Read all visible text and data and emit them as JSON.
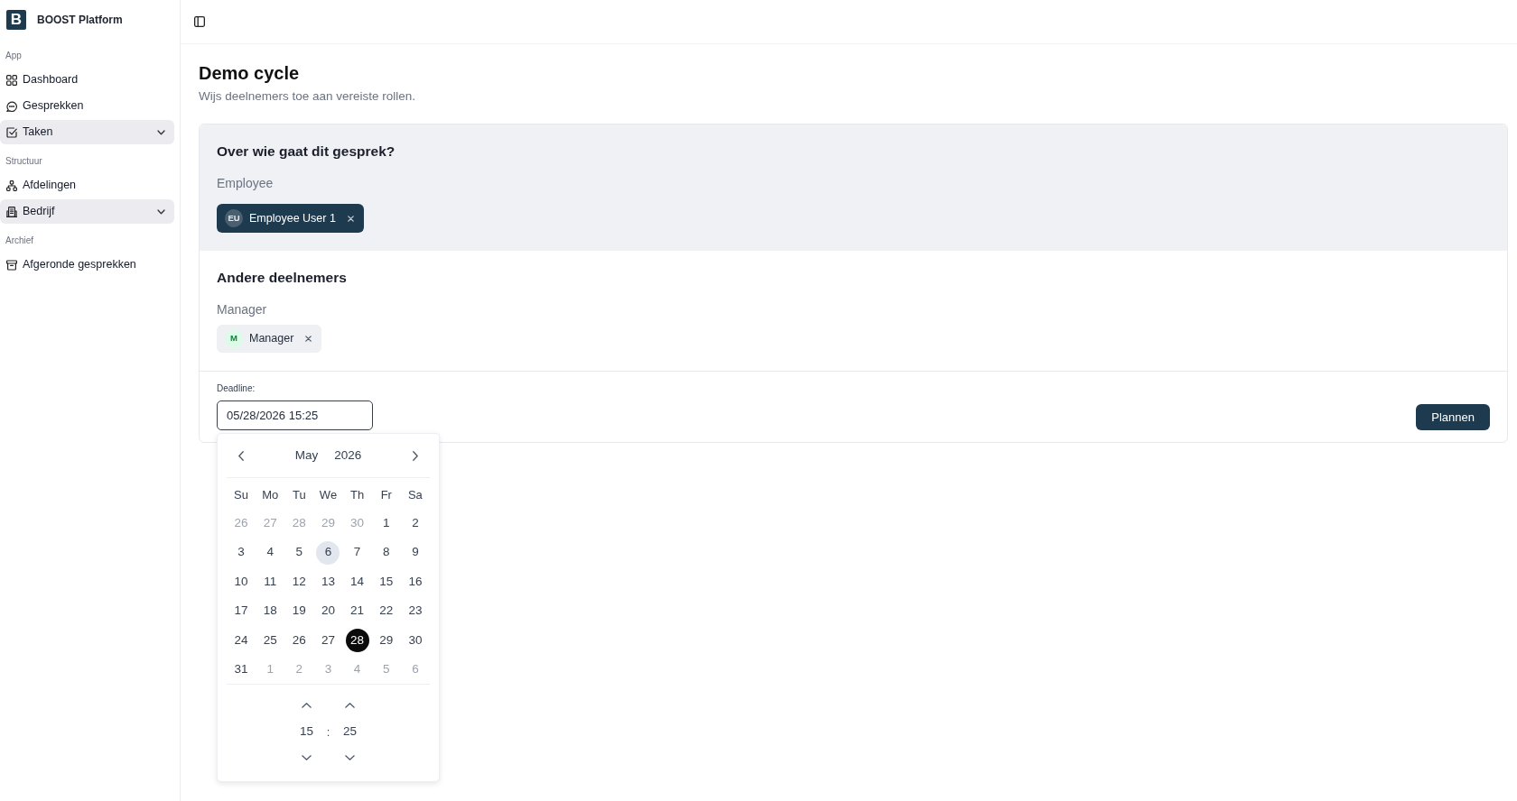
{
  "sidebar": {
    "logo": "B",
    "brand": "BOOST Platform",
    "sections": [
      {
        "label": "App",
        "items": [
          {
            "label": "Dashboard",
            "kind": "link"
          },
          {
            "label": "Gesprekken",
            "kind": "link"
          },
          {
            "label": "Taken",
            "kind": "group"
          }
        ]
      },
      {
        "label": "Structuur",
        "items": [
          {
            "label": "Afdelingen",
            "kind": "link"
          },
          {
            "label": "Bedrijf",
            "kind": "group"
          }
        ]
      },
      {
        "label": "Archief",
        "items": [
          {
            "label": "Afgeronde gesprekken",
            "kind": "link"
          }
        ]
      }
    ]
  },
  "page": {
    "title": "Demo cycle",
    "subtitle": "Wijs deelnemers toe aan vereiste rollen."
  },
  "form": {
    "sections": [
      {
        "kind": "subject",
        "heading": "Over wie gaat dit gesprek?",
        "roles": [
          {
            "label": "Employee",
            "participants": [
              {
                "initials": "EU",
                "name": "Employee User 1"
              }
            ]
          }
        ]
      },
      {
        "kind": "others",
        "heading": "Andere deelnemers",
        "roles": [
          {
            "label": "Manager",
            "participants": [
              {
                "initials": "M",
                "name": "Manager"
              }
            ]
          }
        ]
      }
    ],
    "deadline": {
      "label": "Deadline:",
      "value": "05/28/2026 15:25"
    },
    "submit": "Plannen"
  },
  "datepicker": {
    "month": "May",
    "year": "2026",
    "weekdays": [
      "Su",
      "Mo",
      "Tu",
      "We",
      "Th",
      "Fr",
      "Sa"
    ],
    "weeks": [
      [
        {
          "day": "26",
          "outside": true,
          "today": false,
          "selected": false
        },
        {
          "day": "27",
          "outside": true,
          "today": false,
          "selected": false
        },
        {
          "day": "28",
          "outside": true,
          "today": false,
          "selected": false
        },
        {
          "day": "29",
          "outside": true,
          "today": false,
          "selected": false
        },
        {
          "day": "30",
          "outside": true,
          "today": false,
          "selected": false
        },
        {
          "day": "1",
          "outside": false,
          "today": false,
          "selected": false
        },
        {
          "day": "2",
          "outside": false,
          "today": false,
          "selected": false
        }
      ],
      [
        {
          "day": "3",
          "outside": false,
          "today": false,
          "selected": false
        },
        {
          "day": "4",
          "outside": false,
          "today": false,
          "selected": false
        },
        {
          "day": "5",
          "outside": false,
          "today": false,
          "selected": false
        },
        {
          "day": "6",
          "outside": false,
          "today": true,
          "selected": false
        },
        {
          "day": "7",
          "outside": false,
          "today": false,
          "selected": false
        },
        {
          "day": "8",
          "outside": false,
          "today": false,
          "selected": false
        },
        {
          "day": "9",
          "outside": false,
          "today": false,
          "selected": false
        }
      ],
      [
        {
          "day": "10",
          "outside": false,
          "today": false,
          "selected": false
        },
        {
          "day": "11",
          "outside": false,
          "today": false,
          "selected": false
        },
        {
          "day": "12",
          "outside": false,
          "today": false,
          "selected": false
        },
        {
          "day": "13",
          "outside": false,
          "today": false,
          "selected": false
        },
        {
          "day": "14",
          "outside": false,
          "today": false,
          "selected": false
        },
        {
          "day": "15",
          "outside": false,
          "today": false,
          "selected": false
        },
        {
          "day": "16",
          "outside": false,
          "today": false,
          "selected": false
        }
      ],
      [
        {
          "day": "17",
          "outside": false,
          "today": false,
          "selected": false
        },
        {
          "day": "18",
          "outside": false,
          "today": false,
          "selected": false
        },
        {
          "day": "19",
          "outside": false,
          "today": false,
          "selected": false
        },
        {
          "day": "20",
          "outside": false,
          "today": false,
          "selected": false
        },
        {
          "day": "21",
          "outside": false,
          "today": false,
          "selected": false
        },
        {
          "day": "22",
          "outside": false,
          "today": false,
          "selected": false
        },
        {
          "day": "23",
          "outside": false,
          "today": false,
          "selected": false
        }
      ],
      [
        {
          "day": "24",
          "outside": false,
          "today": false,
          "selected": false
        },
        {
          "day": "25",
          "outside": false,
          "today": false,
          "selected": false
        },
        {
          "day": "26",
          "outside": false,
          "today": false,
          "selected": false
        },
        {
          "day": "27",
          "outside": false,
          "today": false,
          "selected": false
        },
        {
          "day": "28",
          "outside": false,
          "today": false,
          "selected": true
        },
        {
          "day": "29",
          "outside": false,
          "today": false,
          "selected": false
        },
        {
          "day": "30",
          "outside": false,
          "today": false,
          "selected": false
        }
      ],
      [
        {
          "day": "31",
          "outside": false,
          "today": false,
          "selected": false
        },
        {
          "day": "1",
          "outside": true,
          "today": false,
          "selected": false
        },
        {
          "day": "2",
          "outside": true,
          "today": false,
          "selected": false
        },
        {
          "day": "3",
          "outside": true,
          "today": false,
          "selected": false
        },
        {
          "day": "4",
          "outside": true,
          "today": false,
          "selected": false
        },
        {
          "day": "5",
          "outside": true,
          "today": false,
          "selected": false
        },
        {
          "day": "6",
          "outside": true,
          "today": false,
          "selected": false
        }
      ]
    ],
    "time": {
      "hour": "15",
      "separator": ":",
      "minute": "25"
    }
  }
}
